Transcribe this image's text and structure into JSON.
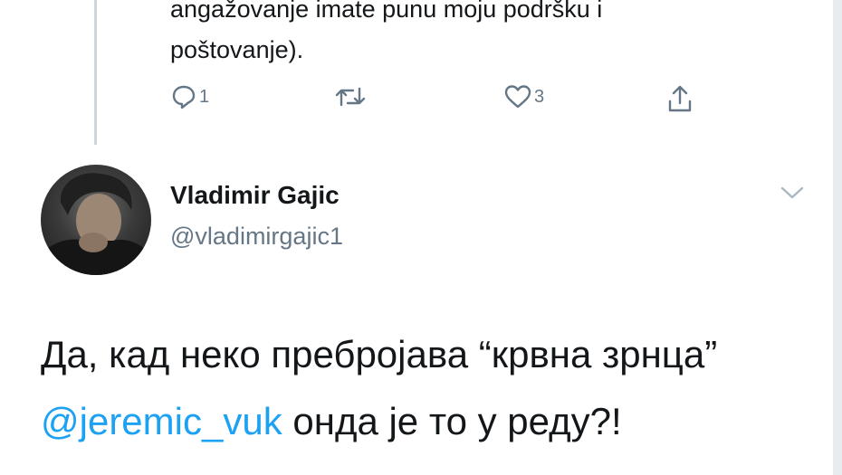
{
  "previous_tweet": {
    "text_line1": "angažovanje imate punu moju podršku i",
    "text_line2": "poštovanje).",
    "reply_count": "1",
    "like_count": "3"
  },
  "tweet": {
    "author_name": "Vladimir Gajic",
    "author_handle": "@vladimirgajic1",
    "text_part1": "Да, кад неко пребројава “крвна зрнца” ",
    "mention": "@jeremic_vuk",
    "text_part2": " онда је то у реду?!"
  },
  "colors": {
    "text": "#14171a",
    "secondary": "#657786",
    "link": "#1da1f2",
    "thread_line": "#ccd6dd"
  }
}
